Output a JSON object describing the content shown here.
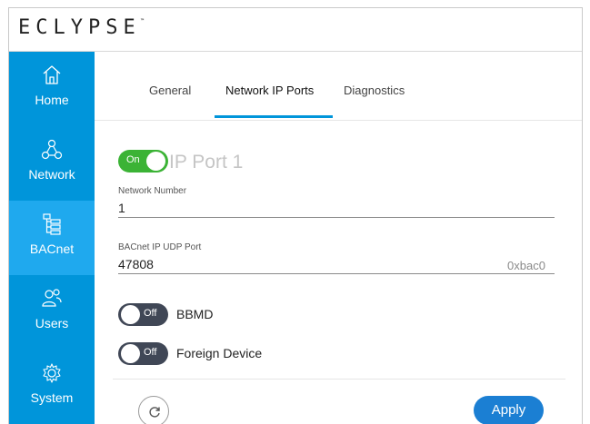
{
  "header": {
    "logo_text": "ECLYPSE",
    "logo_tm": "™"
  },
  "sidebar": {
    "accent": "#0095da",
    "active_color": "#1fa9ee",
    "items": [
      {
        "label": "Home",
        "icon": "home-icon"
      },
      {
        "label": "Network",
        "icon": "network-icon"
      },
      {
        "label": "BACnet",
        "icon": "bacnet-icon",
        "active": true
      },
      {
        "label": "Users",
        "icon": "users-icon"
      },
      {
        "label": "System",
        "icon": "gear-icon"
      }
    ]
  },
  "tabs": [
    {
      "label": "General"
    },
    {
      "label": "Network IP Ports",
      "active": true
    },
    {
      "label": "Diagnostics"
    }
  ],
  "port": {
    "toggle_label": "On",
    "toggle_state": "on",
    "title": "IP Port 1"
  },
  "fields": {
    "network_number": {
      "label": "Network Number",
      "value": "1"
    },
    "udp_port": {
      "label": "BACnet IP UDP Port",
      "value": "47808",
      "hex": "0xbac0"
    }
  },
  "switches": {
    "bbmd": {
      "toggle_label": "Off",
      "label": "BBMD",
      "state": "off"
    },
    "foreign_device": {
      "toggle_label": "Off",
      "label": "Foreign Device",
      "state": "off"
    }
  },
  "footer": {
    "apply_label": "Apply",
    "refresh_icon": "refresh-icon"
  }
}
